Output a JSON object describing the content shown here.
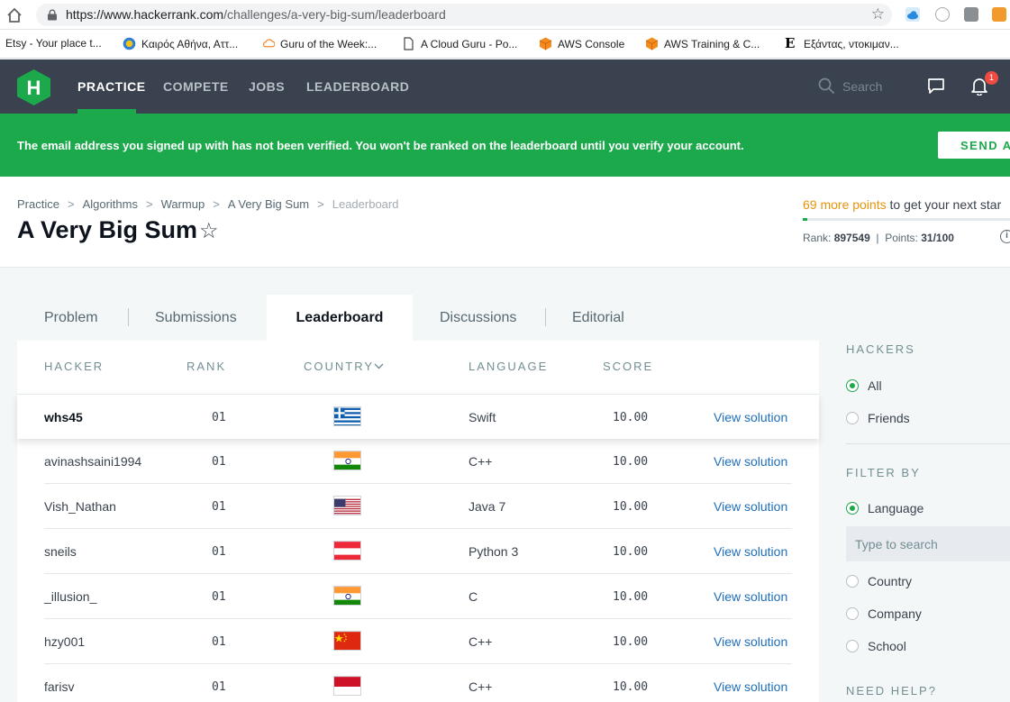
{
  "browser": {
    "url_host": "https://www.hackerrank.com",
    "url_path": "/challenges/a-very-big-sum/leaderboard",
    "bookmarks": [
      {
        "label": "Etsy - Your place t...",
        "icon": "none"
      },
      {
        "label": "Καιρός Αθήνα, Αττ...",
        "icon": "sun-icon"
      },
      {
        "label": "Guru of the Week:...",
        "icon": "cloud-icon"
      },
      {
        "label": "A Cloud Guru - Po...",
        "icon": "page-icon"
      },
      {
        "label": "AWS Console",
        "icon": "aws-cube-icon"
      },
      {
        "label": "AWS Training & C...",
        "icon": "aws-cube-icon"
      },
      {
        "label": "Εξάντας, ντοκιμαν...",
        "icon": "e-letter-icon"
      }
    ]
  },
  "nav": {
    "items": [
      "PRACTICE",
      "COMPETE",
      "JOBS",
      "LEADERBOARD"
    ],
    "active": "PRACTICE",
    "search_placeholder": "Search",
    "notification_count": "1",
    "logo_letter": "H"
  },
  "banner": {
    "text": "The email address you signed up with has not been verified. You won't be ranked on the leaderboard until you verify your account.",
    "button": "SEND AC"
  },
  "challenge": {
    "breadcrumb": [
      "Practice",
      "Algorithms",
      "Warmup",
      "A Very Big Sum",
      "Leaderboard"
    ],
    "title": "A Very Big Sum",
    "points_needed": "69 more points",
    "points_suffix": " to get your next star",
    "progress": 0.02,
    "rank_label": "Rank:",
    "rank": "897549",
    "points_label": "Points:",
    "points": "31/100"
  },
  "tabs": [
    "Problem",
    "Submissions",
    "Leaderboard",
    "Discussions",
    "Editorial"
  ],
  "leaderboard": {
    "headers": {
      "hacker": "HACKER",
      "rank": "RANK",
      "country": "COUNTRY",
      "language": "LANGUAGE",
      "score": "SCORE"
    },
    "link_label": "View solution",
    "rows": [
      {
        "hacker": "whs45",
        "rank": "01",
        "flag": "greece",
        "language": "Swift",
        "score": "10.00"
      },
      {
        "hacker": "avinashsaini1994",
        "rank": "01",
        "flag": "india",
        "language": "C++",
        "score": "10.00"
      },
      {
        "hacker": "Vish_Nathan",
        "rank": "01",
        "flag": "usa",
        "language": "Java 7",
        "score": "10.00"
      },
      {
        "hacker": "sneils",
        "rank": "01",
        "flag": "austria",
        "language": "Python 3",
        "score": "10.00"
      },
      {
        "hacker": "_illusion_",
        "rank": "01",
        "flag": "india",
        "language": "C",
        "score": "10.00"
      },
      {
        "hacker": "hzy001",
        "rank": "01",
        "flag": "china",
        "language": "C++",
        "score": "10.00"
      },
      {
        "hacker": "farisv",
        "rank": "01",
        "flag": "indonesia",
        "language": "C++",
        "score": "10.00"
      }
    ]
  },
  "sidebar": {
    "hackers_heading": "HACKERS",
    "hackers_options": [
      "All",
      "Friends"
    ],
    "hackers_selected": "All",
    "filter_heading": "FILTER BY",
    "filter_options": [
      "Language",
      "Country",
      "Company",
      "School"
    ],
    "filter_selected": "Language",
    "filter_placeholder": "Type to search",
    "help_heading": "NEED HELP?"
  },
  "colors": {
    "brand_green": "#1ba94c",
    "nav_bg": "#39424e",
    "link_blue": "#1f6fba",
    "orange": "#e8930c"
  }
}
